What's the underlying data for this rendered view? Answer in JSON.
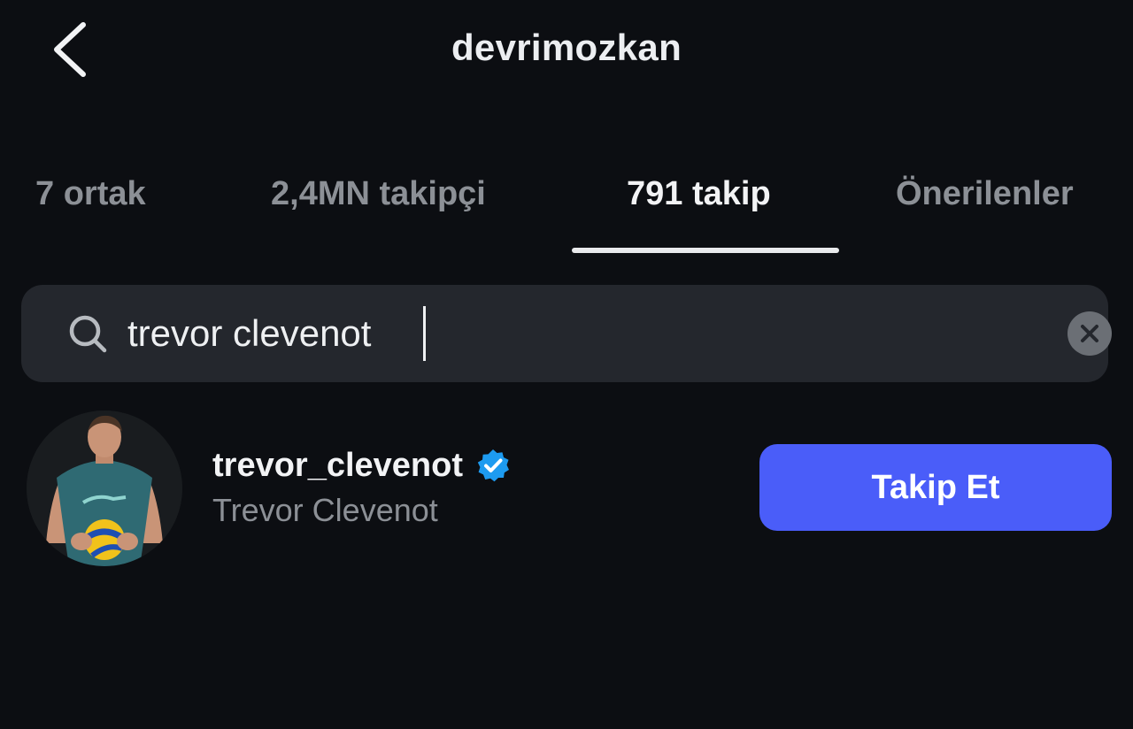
{
  "header": {
    "title": "devrimozkan",
    "back_icon": "chevron-left-icon"
  },
  "tabs": [
    {
      "label": "7 ortak",
      "active": false
    },
    {
      "label": "2,4MN takipçi",
      "active": false
    },
    {
      "label": "791 takip",
      "active": true
    },
    {
      "label": "Önerilenler",
      "active": false
    }
  ],
  "search": {
    "value": "trevor clevenot",
    "placeholder": "",
    "icon": "search-icon",
    "clear_icon": "clear-icon"
  },
  "results": [
    {
      "username": "trevor_clevenot",
      "full_name": "Trevor Clevenot",
      "verified": true,
      "follow_label": "Takip Et"
    }
  ],
  "colors": {
    "background": "#0c0e12",
    "search_field": "#24272d",
    "follow_button": "#4a5df9",
    "verified_badge": "#1d9bf0",
    "muted_text": "#8c9096"
  }
}
